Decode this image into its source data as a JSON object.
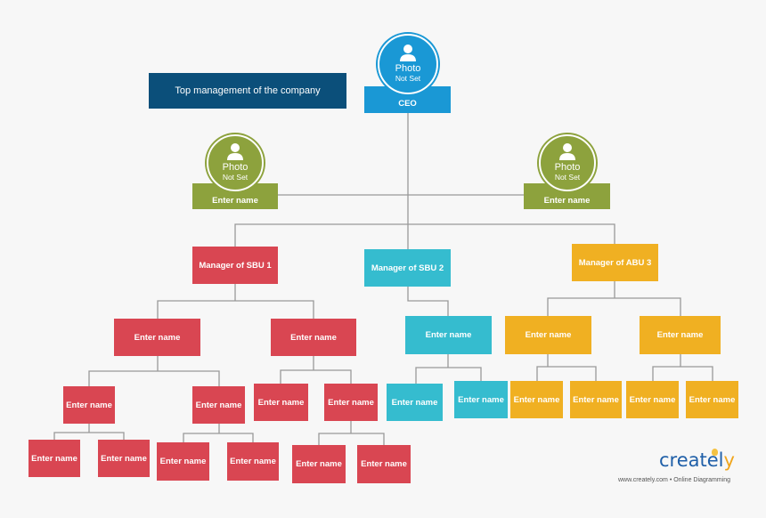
{
  "title_box": {
    "label": "Top management of the company"
  },
  "ceo": {
    "photo": "Photo",
    "photo_status": "Not Set",
    "label": "CEO"
  },
  "top_left": {
    "photo": "Photo",
    "photo_status": "Not Set",
    "label": "Enter name"
  },
  "top_right": {
    "photo": "Photo",
    "photo_status": "Not Set",
    "label": "Enter name"
  },
  "managers": [
    {
      "label": "Manager of SBU 1"
    },
    {
      "label": "Manager of SBU 2"
    },
    {
      "label": "Manager of ABU 3"
    }
  ],
  "placeholder_name": "Enter name",
  "colors": {
    "ceo": "#1a98d5",
    "top_management": "#0b4f7a",
    "assistants": "#8da23d",
    "sbu1": "#d94652",
    "sbu2": "#35bccf",
    "abu3": "#f0b022",
    "connector": "#999999"
  },
  "branding": {
    "logo_text": "creately",
    "tagline": "www.creately.com • Online Diagramming"
  }
}
